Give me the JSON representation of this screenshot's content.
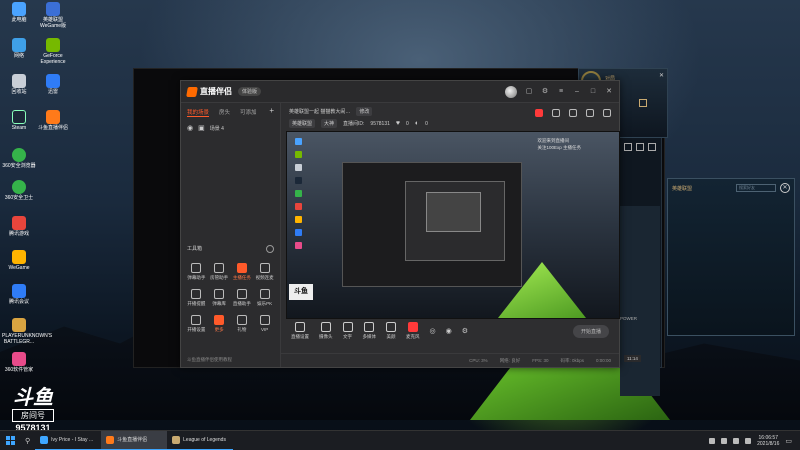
{
  "desktop": {
    "icons": [
      {
        "label": "此电脑",
        "color": "#4aa3ff"
      },
      {
        "label": "英雄联盟 WeGame版",
        "color": "#3b6fd6"
      },
      {
        "label": "网络",
        "color": "#3fa0e8"
      },
      {
        "label": "GeForce Experience",
        "color": "#76b900"
      },
      {
        "label": "回收站",
        "color": "#c8ced6"
      },
      {
        "label": "迅雷",
        "color": "#2f7cf6"
      },
      {
        "label": "Steam",
        "color": "#1b2838"
      },
      {
        "label": "斗鱼直播伴侣",
        "color": "#ff7a1a"
      },
      {
        "label": "360安全浏览器",
        "color": "#35b34a"
      },
      {
        "label": "360安全卫士",
        "color": "#35b34a"
      },
      {
        "label": "腾讯游戏",
        "color": "#e8453c"
      },
      {
        "label": "WeGame",
        "color": "#ffb400"
      },
      {
        "label": "腾讯会议",
        "color": "#2f7cf6"
      },
      {
        "label": "PLAYERUNKNOWN'S BATTLEGR...",
        "color": "#d9a441"
      },
      {
        "label": "360软件管家",
        "color": "#e84b8a"
      }
    ]
  },
  "app": {
    "name": "直播伴侣",
    "badge": "体验版",
    "tabs": [
      "我的场景",
      "房头",
      "可添加"
    ],
    "add_tab": "+",
    "scene_name": "场景 4",
    "tools_title": "工具箱",
    "tools": [
      {
        "label": "弹幕助手",
        "hot": false
      },
      {
        "label": "房管助手",
        "hot": false
      },
      {
        "label": "主播任务",
        "hot": true
      },
      {
        "label": "视频连麦",
        "hot": false
      },
      {
        "label": "开播提醒",
        "hot": false
      },
      {
        "label": "弹幕库",
        "hot": false
      },
      {
        "label": "直播助手",
        "hot": false
      },
      {
        "label": "娱乐PK",
        "hot": false
      },
      {
        "label": "开播设置",
        "hot": false
      },
      {
        "label": "更多",
        "hot": true
      },
      {
        "label": "礼物",
        "hot": false
      },
      {
        "label": "VIP",
        "hot": false
      }
    ],
    "footer": "斗鱼直播伴侣使用教程",
    "live_header": {
      "title": "英雄联盟一起 猫猫教大闹…",
      "edit": "修改",
      "category": "英雄联盟",
      "category2": "大神",
      "room_label": "直播间ID:",
      "room_id": "9578131",
      "likes": "0",
      "viewers": "0"
    },
    "preview_overlay": [
      "欢迎来到直播间",
      "关注100Exp 主播任务"
    ],
    "toolbar": [
      {
        "label": "直播设置",
        "red": false
      },
      {
        "label": "摄像头",
        "red": false
      },
      {
        "label": "文字",
        "red": false
      },
      {
        "label": "多媒体",
        "red": false
      },
      {
        "label": "美颜",
        "red": false
      },
      {
        "label": "麦克风",
        "red": true
      }
    ],
    "go_live": "开始直播",
    "status": [
      "CPU: 3%",
      "网络: 良好",
      "FPS: 30",
      "码率: 0kbps",
      "0:00:00"
    ]
  },
  "overlay": {
    "logo": "斗鱼",
    "room_label": "房间号",
    "room_number": "9578131"
  },
  "right_panel": {
    "title": "对局",
    "chat_title": "英雄联盟",
    "chat_search": "搜索好友"
  },
  "side_label": "POWER",
  "side_time": "11:14",
  "taskbar": {
    "apps": [
      {
        "label": "Ivy Price - I Stay ...",
        "color": "#3ea6ff",
        "active": false
      },
      {
        "label": "斗鱼直播伴侣",
        "color": "#ff7a1a",
        "active": true
      },
      {
        "label": "League of Legends",
        "color": "#c9aa71",
        "active": false
      }
    ],
    "time": "16:06:57",
    "date": "2021/8/16"
  },
  "colors": {
    "accent": "#ff5a2a",
    "taskbar": "#1b1d22",
    "windows_blue": "#3ea6ff"
  }
}
